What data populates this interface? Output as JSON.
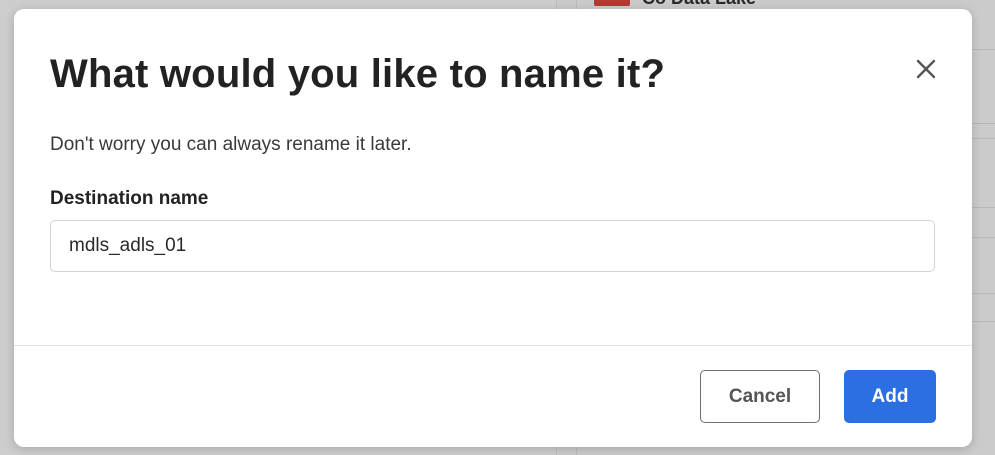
{
  "background": {
    "heading_text": "Co Data Lake"
  },
  "modal": {
    "title": "What would you like to name it?",
    "subtitle": "Don't worry you can always rename it later.",
    "close_icon": "close-icon",
    "field": {
      "label": "Destination name",
      "value": "mdls_adls_01"
    },
    "buttons": {
      "cancel_label": "Cancel",
      "add_label": "Add"
    }
  },
  "colors": {
    "primary": "#2b6fe3",
    "title_text": "#222222",
    "overlay": "#cdcdcd"
  }
}
